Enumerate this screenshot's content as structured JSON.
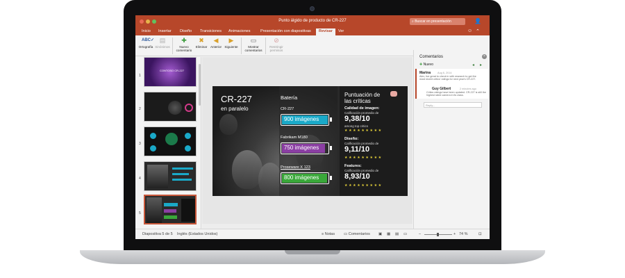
{
  "window": {
    "title": "Punto álgido de producto de CR-227",
    "search_placeholder": "Buscar en presentación"
  },
  "tabs": [
    "Inicio",
    "Insertar",
    "Diseño",
    "Transiciones",
    "Animaciones",
    "Presentación con diapositivas",
    "Revisar",
    "Ver"
  ],
  "active_tab": "Revisar",
  "ribbon": {
    "buttons": [
      {
        "label1": "Ortografía",
        "label2": "",
        "icon": "spelling-icon",
        "enabled": true
      },
      {
        "label1": "Sinónimos",
        "label2": "",
        "icon": "thesaurus-icon",
        "enabled": false
      },
      {
        "label1": "Nuevo",
        "label2": "comentario",
        "icon": "new-comment-icon",
        "enabled": true
      },
      {
        "label1": "Eliminar",
        "label2": "",
        "icon": "delete-comment-icon",
        "enabled": true
      },
      {
        "label1": "Anterior",
        "label2": "",
        "icon": "previous-comment-icon",
        "enabled": true
      },
      {
        "label1": "Siguiente",
        "label2": "",
        "icon": "next-comment-icon",
        "enabled": true
      },
      {
        "label1": "Mostrar",
        "label2": "comentarios",
        "icon": "show-comments-icon",
        "enabled": true
      },
      {
        "label1": "Restringir",
        "label2": "permisos",
        "icon": "restrict-permission-icon",
        "enabled": false
      }
    ]
  },
  "thumbnails": {
    "numbers": [
      "1",
      "2",
      "3",
      "4",
      "5"
    ],
    "slide1_text": "CONTOSO CR-227",
    "selected": 5
  },
  "slide": {
    "title": "CR-227",
    "subtitle": "en paralelo",
    "battery_heading": "Batería",
    "products": [
      {
        "name": "CR-227",
        "value": "900 imágenes",
        "color": "#1aa9c8",
        "fraction": 1.0
      },
      {
        "name": "Fabrikam M180",
        "value": "750 imágenes",
        "color": "#8b3fa3",
        "fraction": 0.92
      },
      {
        "name": "Proseware X 123",
        "value": "800 imágenes",
        "color": "#3aa83a",
        "fraction": 0.96
      }
    ],
    "review_title_1": "Puntuación de",
    "review_title_2": "las críticas",
    "sections": [
      {
        "heading": "Calidad de imagen:",
        "score": "9,38/10",
        "note": "among top critics",
        "stars": "★★★★★★★★★"
      },
      {
        "heading": "Diseño:",
        "note_before": "Calificación promedio de",
        "score": "9,11/10",
        "stars": "★★★★★★★★★"
      },
      {
        "heading": "Features:",
        "note_before": "Calificación promedio de",
        "score": "8,93/10",
        "stars": "★★★★★★★★★"
      }
    ],
    "section1_note_before": "Calificación promedio de"
  },
  "comments": {
    "header": "Comentarios",
    "new_label": "Nuevo",
    "items": [
      {
        "author": "Marina",
        "date": "Aug 6, 2014",
        "text": "Alex, fue great to check in with research to get the most recent critics' ratings for next year's CR-227."
      },
      {
        "author": "Guy Gilbert",
        "date": "2 minutes ago",
        "text": "Critics ratings have been updated. CR-227 is still the highest rated camera in its class."
      }
    ],
    "reply_placeholder": "Reply..."
  },
  "status": {
    "slide_info": "Diapositiva 5 de 5",
    "language": "Inglés (Estados Unidos)",
    "notes": "Notas",
    "comments": "Comentarios",
    "zoom": "74 %"
  },
  "colors": {
    "accent": "#b7472a",
    "battery_cyan": "#1aa9c8",
    "battery_purple": "#8b3fa3",
    "battery_green": "#3aa83a"
  }
}
